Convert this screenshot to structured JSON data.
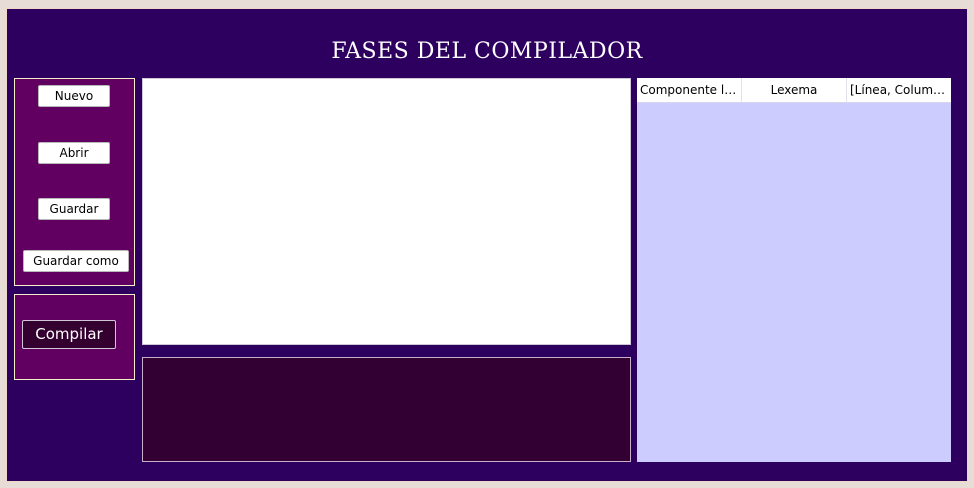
{
  "window": {
    "title": "FASES DEL COMPILADOR"
  },
  "file_panel": {
    "new_label": "Nuevo",
    "open_label": "Abrir",
    "save_label": "Guardar",
    "save_as_label": "Guardar como"
  },
  "compile_panel": {
    "compile_label": "Compilar"
  },
  "editor": {
    "content": ""
  },
  "console": {
    "content": ""
  },
  "token_table": {
    "columns": [
      "Componente léxico",
      "Lexema",
      "[Línea, Columna]"
    ],
    "rows": []
  },
  "colors": {
    "window_bg": "#2d0060",
    "panel_bg": "#610060",
    "console_bg": "#330033",
    "table_bg": "#ccccff",
    "panel_border": "#f5f0c8"
  }
}
